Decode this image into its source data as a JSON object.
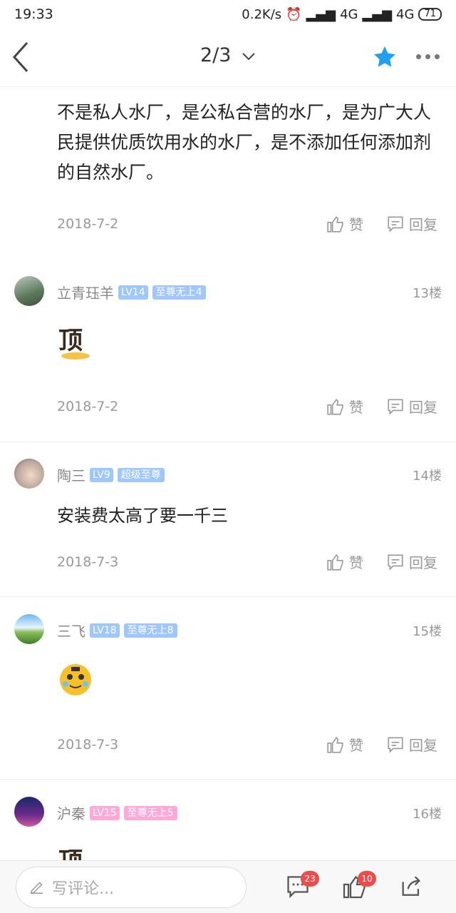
{
  "status": {
    "time": "19:33",
    "speed": "0.2K/s",
    "net1": "4G",
    "net2": "4G",
    "battery": "71"
  },
  "header": {
    "title": "2/3"
  },
  "post": {
    "text": "不是私人水厂，是公私合营的水厂，是为广大人民提供优质饮用水的水厂，是不添加任何添加剂的自然水厂。",
    "date": "2018-7-2"
  },
  "actions": {
    "like": "赞",
    "reply": "回复"
  },
  "floors": [
    {
      "name": "立青珏羊",
      "level": "LV14",
      "tag": "至尊无上4",
      "floor": "13楼",
      "date": "2018-7-2",
      "content_type": "emoji-ding"
    },
    {
      "name": "陶三",
      "level": "LV9",
      "tag": "超级至尊",
      "floor": "14楼",
      "date": "2018-7-3",
      "text": "安装费太高了要一千三"
    },
    {
      "name": "三飞",
      "level": "LV18",
      "tag": "至尊无上8",
      "floor": "15楼",
      "date": "2018-7-3",
      "content_type": "emoji-tiger"
    },
    {
      "name": "沪秦",
      "level": "LV15",
      "tag": "至尊无上5",
      "floor": "16楼"
    }
  ],
  "bottom": {
    "placeholder": "写评论...",
    "comment_count": "23",
    "like_count": "10"
  },
  "colors": {
    "accent": "#1da1f2",
    "badge": "#f04b4b",
    "level_blue": "#9ec6ff",
    "level_pink": "#ffa9d8"
  }
}
